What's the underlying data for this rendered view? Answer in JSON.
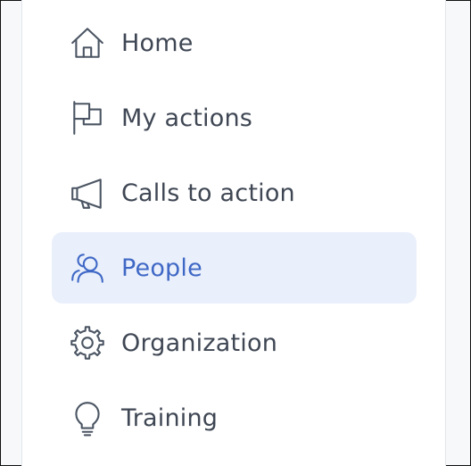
{
  "sidebar": {
    "items": [
      {
        "label": "Home",
        "icon": "home-icon",
        "active": false
      },
      {
        "label": "My actions",
        "icon": "flag-icon",
        "active": false
      },
      {
        "label": "Calls to action",
        "icon": "megaphone-icon",
        "active": false
      },
      {
        "label": "People",
        "icon": "people-icon",
        "active": true
      },
      {
        "label": "Organization",
        "icon": "gear-icon",
        "active": false
      },
      {
        "label": "Training",
        "icon": "lightbulb-icon",
        "active": false
      }
    ]
  },
  "colors": {
    "active_background": "#eaf0fb",
    "active_text": "#3f68c6",
    "default_text": "#3f4754",
    "icon_default": "#4b5563"
  }
}
